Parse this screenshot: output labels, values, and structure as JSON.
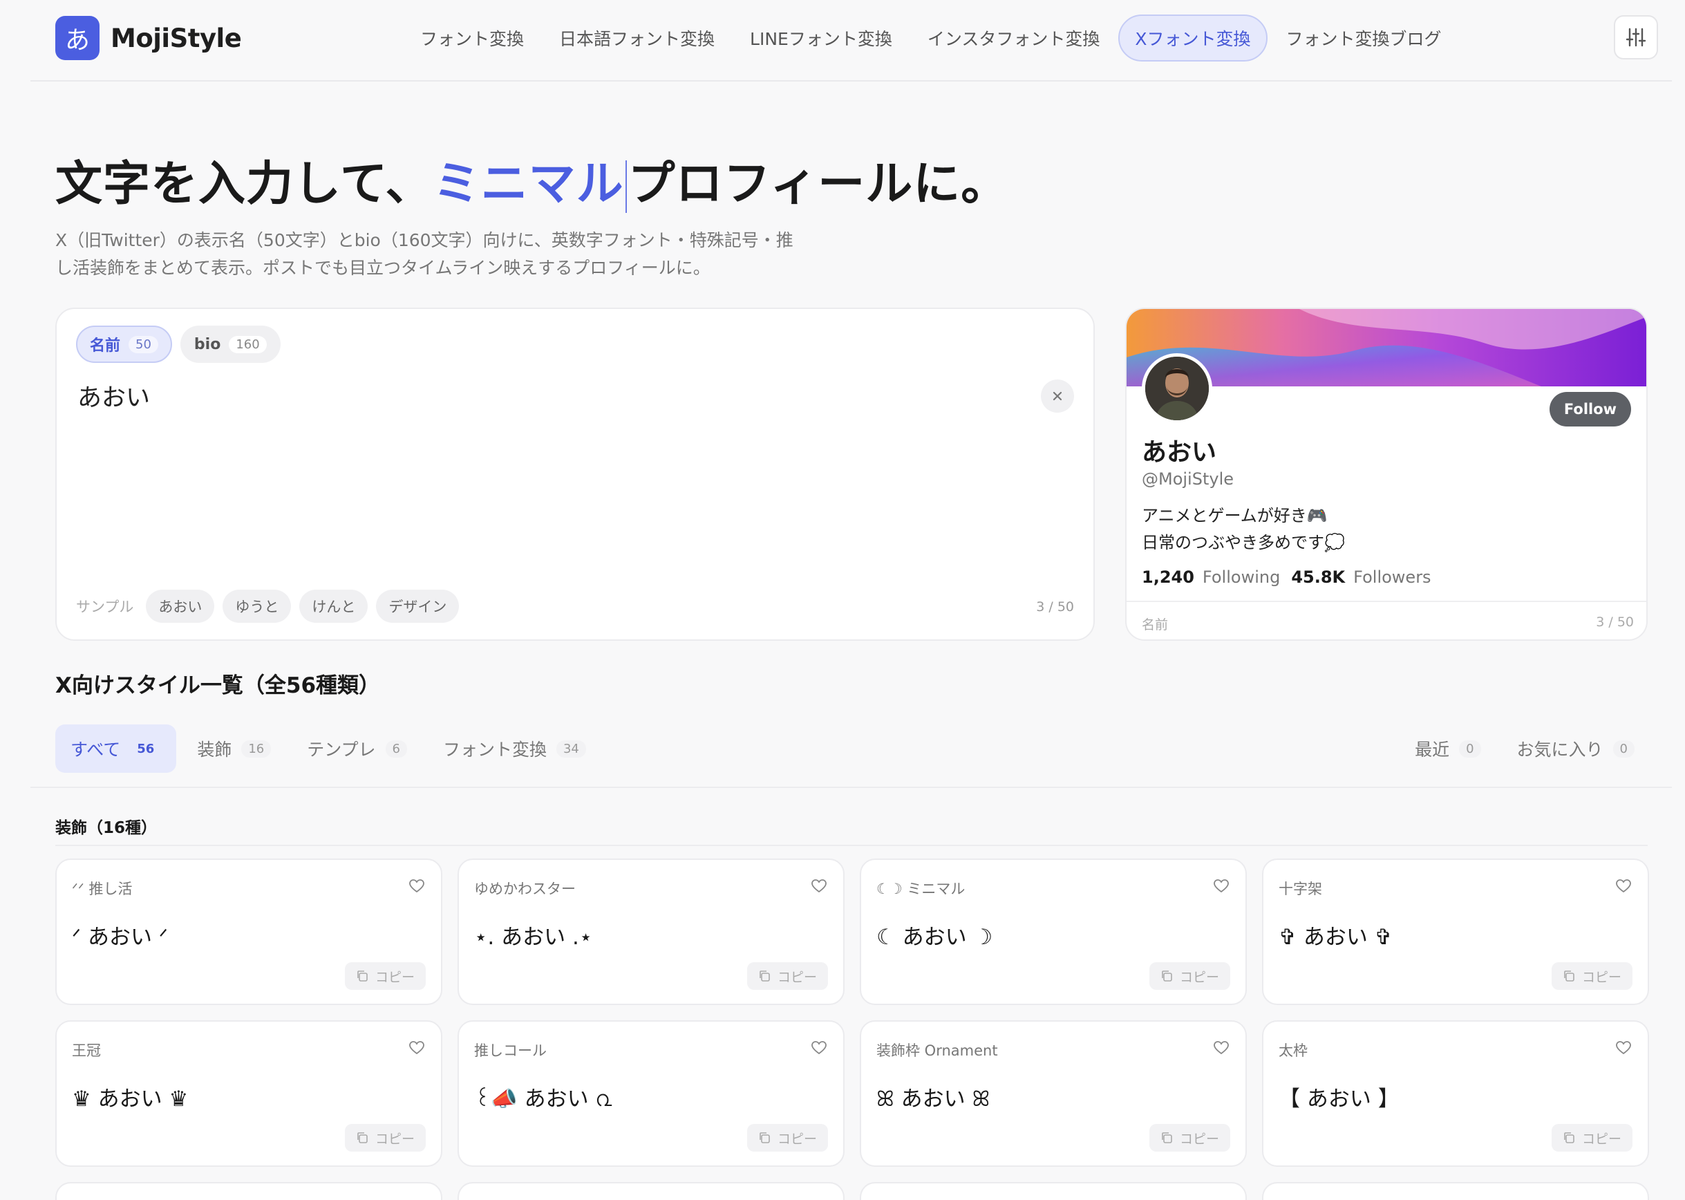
{
  "header": {
    "logo_mark": "あ",
    "logo_text": "MojiStyle",
    "nav": [
      {
        "label": "フォント変換",
        "active": false
      },
      {
        "label": "日本語フォント変換",
        "active": false
      },
      {
        "label": "LINEフォント変換",
        "active": false
      },
      {
        "label": "インスタフォント変換",
        "active": false
      },
      {
        "label": "Xフォント変換",
        "active": true
      },
      {
        "label": "フォント変換ブログ",
        "active": false
      }
    ],
    "settings_icon": "sliders-icon"
  },
  "hero": {
    "title_before": "文字を入力して、",
    "title_accent": "ミニマル",
    "title_after": "プロフィールに。",
    "desc_line1": "X（旧Twitter）の表示名（50文字）とbio（160文字）向けに、英数字フォント・特殊記号・推",
    "desc_line2": "し活装飾をまとめて表示。ポストでも目立つタイムライン映えするプロフィールに。"
  },
  "editor": {
    "tabs": [
      {
        "label": "名前",
        "count": "50",
        "active": true
      },
      {
        "label": "bio",
        "count": "160",
        "active": false
      }
    ],
    "text": "あおい",
    "samples_label": "サンプル",
    "samples": [
      "あおい",
      "ゆうと",
      "けんと",
      "デザイン"
    ],
    "count": "3 / 50"
  },
  "profile": {
    "follow_label": "Follow",
    "name": "あおい",
    "handle": "@MojiStyle",
    "bio_line1": "アニメとゲームが好き🎮",
    "bio_line2": "日常のつぶやき多めです💭",
    "following_count": "1,240",
    "following_label": "Following",
    "followers_count": "45.8K",
    "followers_label": "Followers",
    "footer_label": "名前",
    "footer_count": "3 / 50"
  },
  "styles": {
    "title": "X向けスタイル一覧（全56種類）",
    "filters": [
      {
        "label": "すべて",
        "count": "56",
        "active": true
      },
      {
        "label": "装飾",
        "count": "16",
        "active": false
      },
      {
        "label": "テンプレ",
        "count": "6",
        "active": false
      },
      {
        "label": "フォント変換",
        "count": "34",
        "active": false
      }
    ],
    "recent": {
      "label": "最近",
      "count": "0"
    },
    "favorites": {
      "label": "お気に入り",
      "count": "0"
    },
    "group_title": "装飾（16種）",
    "copy_label": "コピー",
    "cards": [
      {
        "name": "ᐟᐟ 推し活",
        "value": "ᐟ あおい ᐟ"
      },
      {
        "name": "ゆめかわスター",
        "value": "⋆. あおい .⋆"
      },
      {
        "name": "☾☽ ミニマル",
        "value": "☾ あおい ☽"
      },
      {
        "name": "十字架",
        "value": "✞ あおい ✞"
      },
      {
        "name": "王冠",
        "value": "♛ あおい ♛"
      },
      {
        "name": "推しコール",
        "value": "꒰📣 あおい ൨"
      },
      {
        "name": "装飾枠 Ornament",
        "value": "ꕤ あおい ꕤ"
      },
      {
        "name": "太枠",
        "value": "【 あおい 】"
      }
    ]
  }
}
